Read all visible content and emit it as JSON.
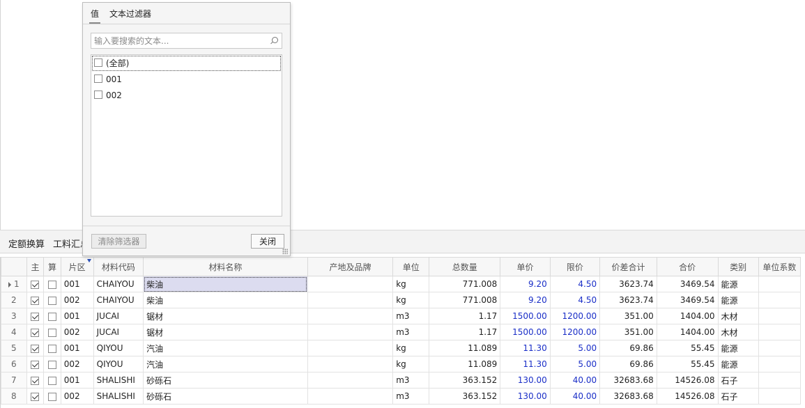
{
  "tabs": [
    "定额换算",
    "工料汇总"
  ],
  "filter_popup": {
    "tabs": [
      "值",
      "文本过滤器"
    ],
    "search_placeholder": "输入要搜索的文本...",
    "items": [
      {
        "label": "(全部)",
        "checked": false
      },
      {
        "label": "001",
        "checked": false
      },
      {
        "label": "002",
        "checked": false
      }
    ],
    "clear_button": "清除筛选器",
    "close_button": "关闭"
  },
  "grid": {
    "columns": [
      "",
      "主",
      "算",
      "片区",
      "材料代码",
      "材料名称",
      "产地及品牌",
      "单位",
      "总数量",
      "单价",
      "限价",
      "价差合计",
      "合价",
      "类别",
      "单位系数"
    ],
    "rows": [
      {
        "no": "1",
        "main": true,
        "calc": false,
        "area": "001",
        "code": "CHAIYOU",
        "name": "柴油",
        "origin": "",
        "unit": "kg",
        "qty": "771.008",
        "price": "9.20",
        "limit": "4.50",
        "diff": "3623.74",
        "total": "3469.54",
        "category": "能源",
        "factor": ""
      },
      {
        "no": "2",
        "main": true,
        "calc": false,
        "area": "002",
        "code": "CHAIYOU",
        "name": "柴油",
        "origin": "",
        "unit": "kg",
        "qty": "771.008",
        "price": "9.20",
        "limit": "4.50",
        "diff": "3623.74",
        "total": "3469.54",
        "category": "能源",
        "factor": ""
      },
      {
        "no": "3",
        "main": true,
        "calc": false,
        "area": "001",
        "code": "JUCAI",
        "name": "锯材",
        "origin": "",
        "unit": "m3",
        "qty": "1.17",
        "price": "1500.00",
        "limit": "1200.00",
        "diff": "351.00",
        "total": "1404.00",
        "category": "木材",
        "factor": ""
      },
      {
        "no": "4",
        "main": true,
        "calc": false,
        "area": "002",
        "code": "JUCAI",
        "name": "锯材",
        "origin": "",
        "unit": "m3",
        "qty": "1.17",
        "price": "1500.00",
        "limit": "1200.00",
        "diff": "351.00",
        "total": "1404.00",
        "category": "木材",
        "factor": ""
      },
      {
        "no": "5",
        "main": true,
        "calc": false,
        "area": "001",
        "code": "QIYOU",
        "name": "汽油",
        "origin": "",
        "unit": "kg",
        "qty": "11.089",
        "price": "11.30",
        "limit": "5.00",
        "diff": "69.86",
        "total": "55.45",
        "category": "能源",
        "factor": ""
      },
      {
        "no": "6",
        "main": true,
        "calc": false,
        "area": "002",
        "code": "QIYOU",
        "name": "汽油",
        "origin": "",
        "unit": "kg",
        "qty": "11.089",
        "price": "11.30",
        "limit": "5.00",
        "diff": "69.86",
        "total": "55.45",
        "category": "能源",
        "factor": ""
      },
      {
        "no": "7",
        "main": true,
        "calc": false,
        "area": "001",
        "code": "SHALISHI",
        "name": "砂砾石",
        "origin": "",
        "unit": "m3",
        "qty": "363.152",
        "price": "130.00",
        "limit": "40.00",
        "diff": "32683.68",
        "total": "14526.08",
        "category": "石子",
        "factor": ""
      },
      {
        "no": "8",
        "main": true,
        "calc": false,
        "area": "002",
        "code": "SHALISHI",
        "name": "砂砾石",
        "origin": "",
        "unit": "m3",
        "qty": "363.152",
        "price": "130.00",
        "limit": "40.00",
        "diff": "32683.68",
        "total": "14526.08",
        "category": "石子",
        "factor": ""
      }
    ]
  }
}
